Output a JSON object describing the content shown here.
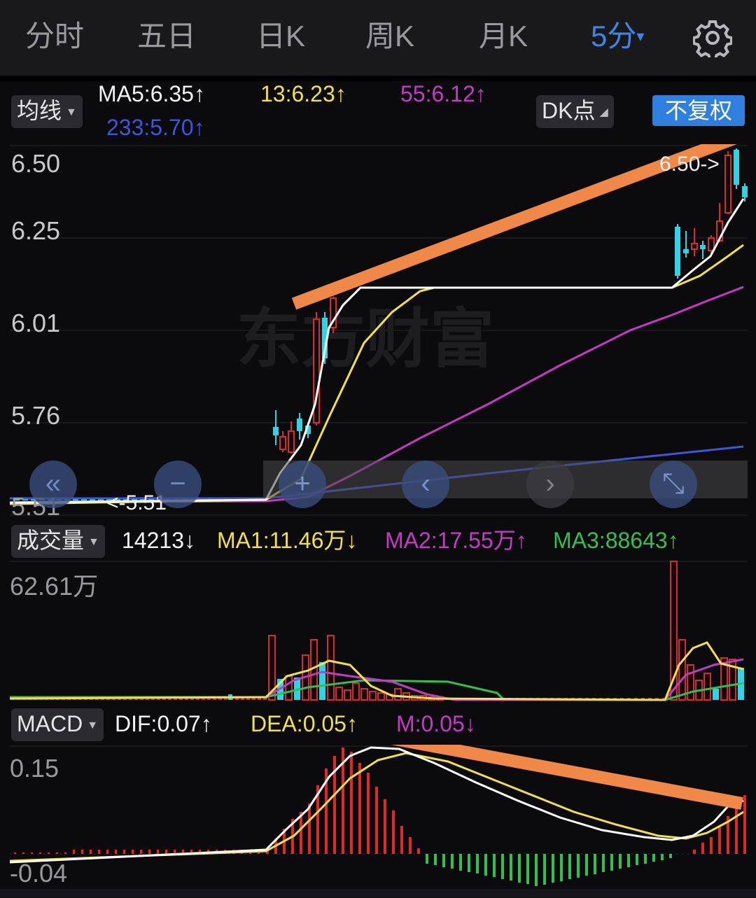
{
  "tabs": [
    "分时",
    "五日",
    "日K",
    "周K",
    "月K",
    "5分"
  ],
  "active_tab_arrow": "▾",
  "main": {
    "indicator_label": "均线",
    "ma5": "MA5:6.35",
    "ma13": "13:6.23",
    "ma55": "55:6.12",
    "ma233": "233:5.70",
    "up_arrow": "↑",
    "down_arrow": "↓",
    "dk_label": "DK点",
    "fq_label": "不复权",
    "y_labels": [
      "6.50",
      "6.25",
      "6.01",
      "5.76",
      "5.51"
    ],
    "high_marker": "6.50->",
    "low_marker": "<-5.51",
    "watermark": "东方财富"
  },
  "volume": {
    "label": "成交量",
    "value": "14213",
    "ma1": "MA1:11.46万",
    "ma2": "MA2:17.55万",
    "ma3": "MA3:88643",
    "y_label": "62.61万"
  },
  "macd": {
    "label": "MACD",
    "dif": "DIF:0.07",
    "dea": "DEA:0.05",
    "m": "M:0.05",
    "y_top": "0.15",
    "y_bottom": "-0.04"
  },
  "controls": [
    "«",
    "−",
    "+",
    "‹",
    "›",
    "⤡"
  ],
  "colors": {
    "up": "#e0282a",
    "down": "#32d2e2",
    "ma5": "#ffffff",
    "ma13": "#f0e04a",
    "ma55": "#c43ac4",
    "ma233": "#3c58d8",
    "trend": "#f08848",
    "vol_ma3": "#30c050"
  }
}
